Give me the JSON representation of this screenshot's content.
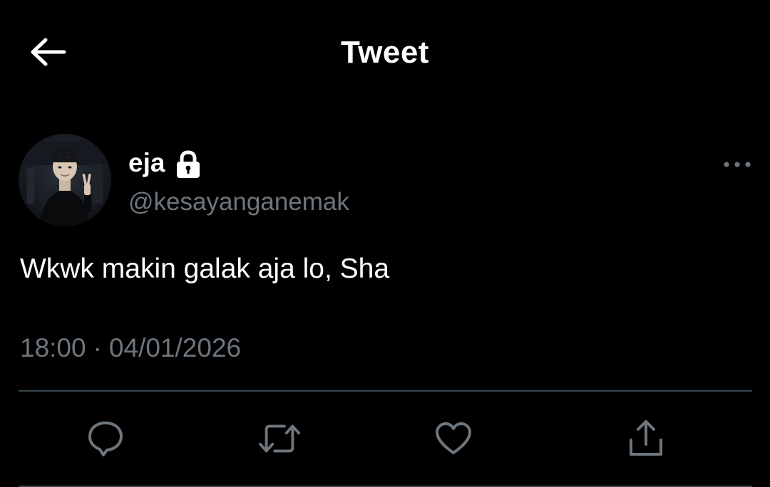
{
  "header": {
    "title": "Tweet",
    "back_icon": "arrow-left-icon"
  },
  "tweet": {
    "author": {
      "display_name": "eja",
      "handle": "@kesayanganemak",
      "protected_icon": "lock-icon"
    },
    "text": "Wkwk makin galak aja lo, Sha",
    "time": "18:00",
    "separator": "·",
    "date": "04/01/2026"
  },
  "actions": [
    {
      "name": "reply",
      "icon": "comment-icon"
    },
    {
      "name": "retweet",
      "icon": "retweet-icon"
    },
    {
      "name": "like",
      "icon": "heart-icon"
    },
    {
      "name": "share",
      "icon": "share-icon"
    }
  ],
  "colors": {
    "background": "#000000",
    "text": "#ffffff",
    "secondary_text": "#6e767d",
    "divider": "#38444d"
  }
}
